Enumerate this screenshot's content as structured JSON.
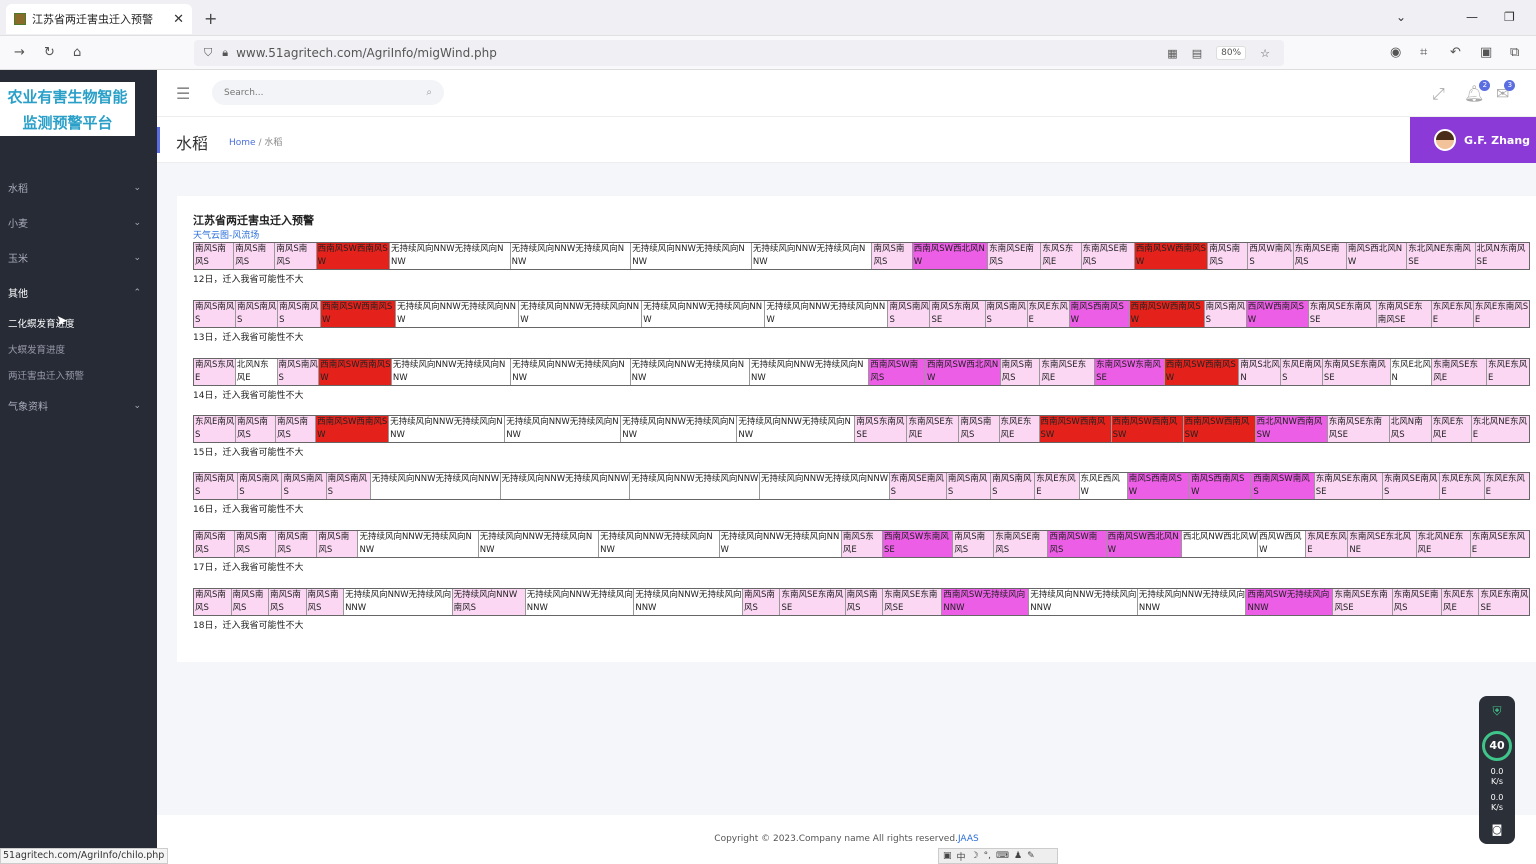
{
  "browser": {
    "tab_title": "江苏省两迁害虫迁入预警",
    "tab_close": "✕",
    "new_tab": "+",
    "url": "www.51agritech.com/AgriInfo/migWind.php",
    "zoom": "80%",
    "status_url": "51agritech.com/AgriInfo/chilo.php"
  },
  "sidebar": {
    "logo_line1": "农业有害生物智能",
    "logo_line2": "监测预警平台",
    "items": [
      {
        "label": "水稻"
      },
      {
        "label": "小麦"
      },
      {
        "label": "玉米"
      },
      {
        "label": "其他"
      }
    ],
    "subitems": [
      {
        "label": "二化螟发育进度"
      },
      {
        "label": "大螟发育进度"
      },
      {
        "label": "两迁害虫迁入预警"
      }
    ],
    "last_item": {
      "label": "气象资料"
    }
  },
  "topbar": {
    "search_placeholder": "Search...",
    "notif_count": "2",
    "mail_count": "3"
  },
  "page": {
    "title": "水稻",
    "crumb_home": "Home",
    "crumb_sep": "/",
    "crumb_current": "水稻",
    "user_name": "G.F. Zhang"
  },
  "card": {
    "title": "江苏省两迁害虫迁入预警",
    "link": "天气云图-风流场"
  },
  "wind_rows": [
    {
      "note": "12日，迁入我省可能性不大",
      "cells": [
        {
          "t": "南风S南风S",
          "c": "p",
          "w": 40
        },
        {
          "t": "南风S南风S",
          "c": "p",
          "w": 41
        },
        {
          "t": "南风S南风S",
          "c": "p",
          "w": 41
        },
        {
          "t": "西南风SW西南风SW",
          "c": "r",
          "w": 73
        },
        {
          "t": "无持续风向NNW无持续风向NNW",
          "c": "w",
          "w": 120
        },
        {
          "t": "无持续风向NNW无持续风向NNW",
          "c": "w",
          "w": 120
        },
        {
          "t": "无持续风向NNW无持续风向NNW",
          "c": "w",
          "w": 120
        },
        {
          "t": "无持续风向NNW无持续风向NNW",
          "c": "w",
          "w": 120
        },
        {
          "t": "南风S南风S",
          "c": "p",
          "w": 40
        },
        {
          "t": "西南风SW西北风NW",
          "c": "m",
          "w": 75
        },
        {
          "t": "东南风SE南风S",
          "c": "p",
          "w": 53
        },
        {
          "t": "东风S东风E",
          "c": "p",
          "w": 40
        },
        {
          "t": "东南风SE南风S",
          "c": "p",
          "w": 53
        },
        {
          "t": "西南风SW西南风SW",
          "c": "r",
          "w": 73
        },
        {
          "t": "南风S南风S",
          "c": "p",
          "w": 40
        },
        {
          "t": "西风W南风S",
          "c": "p",
          "w": 45
        },
        {
          "t": "东南风SE南风S",
          "c": "p",
          "w": 53
        },
        {
          "t": "南风S西北风NW",
          "c": "p",
          "w": 60
        },
        {
          "t": "东北风NE东南风SE",
          "c": "p",
          "w": 68
        },
        {
          "t": "北风N东南风SE",
          "c": "p",
          "w": 53
        }
      ]
    },
    {
      "note": "13日，迁入我省可能性不大",
      "cells": [
        {
          "t": "南风S南风S",
          "c": "p",
          "w": 42
        },
        {
          "t": "南风S南风S",
          "c": "p",
          "w": 42
        },
        {
          "t": "南风S南风S",
          "c": "p",
          "w": 43
        },
        {
          "t": "西南风SW西南风SW",
          "c": "r",
          "w": 75
        },
        {
          "t": "无持续风向NNW无持续风向NNW",
          "c": "w",
          "w": 123
        },
        {
          "t": "无持续风向NNW无持续风向NNW",
          "c": "w",
          "w": 123
        },
        {
          "t": "无持续风向NNW无持续风向NNW",
          "c": "w",
          "w": 123
        },
        {
          "t": "无持续风向NNW无持续风向NNW",
          "c": "w",
          "w": 123
        },
        {
          "t": "南风S南风S",
          "c": "p",
          "w": 42
        },
        {
          "t": "南风S东南风SE",
          "c": "p",
          "w": 55
        },
        {
          "t": "南风S南风S",
          "c": "p",
          "w": 42
        },
        {
          "t": "东风E东风E",
          "c": "p",
          "w": 42
        },
        {
          "t": "南风S西南风SW",
          "c": "m",
          "w": 60
        },
        {
          "t": "西南风SW西南风SW",
          "c": "r",
          "w": 75
        },
        {
          "t": "南风S南风S",
          "c": "p",
          "w": 42
        },
        {
          "t": "西风W西南风SW",
          "c": "m",
          "w": 62
        },
        {
          "t": "东南风SE东南风SE",
          "c": "p",
          "w": 68
        },
        {
          "t": "东南风SE东南风SE",
          "c": "p",
          "w": 55
        },
        {
          "t": "东风E东风E",
          "c": "p",
          "w": 42
        },
        {
          "t": "东风E东南风SE",
          "c": "p",
          "w": 55
        }
      ]
    },
    {
      "note": "14日，迁入我省可能性不大",
      "cells": [
        {
          "t": "南风S东风E",
          "c": "p",
          "w": 42
        },
        {
          "t": "北风N东风E",
          "c": "w",
          "w": 42
        },
        {
          "t": "南风S南风S",
          "c": "p",
          "w": 42
        },
        {
          "t": "西南风SW西南风SW",
          "c": "r",
          "w": 73
        },
        {
          "t": "无持续风向NNW无持续风向NNW",
          "c": "w",
          "w": 120
        },
        {
          "t": "无持续风向NNW无持续风向NNW",
          "c": "w",
          "w": 120
        },
        {
          "t": "无持续风向NNW无持续风向NNW",
          "c": "w",
          "w": 120
        },
        {
          "t": "无持续风向NNW无持续风向NNW",
          "c": "w",
          "w": 120
        },
        {
          "t": "西南风SW南风S",
          "c": "m",
          "w": 57
        },
        {
          "t": "西南风SW西北风NW",
          "c": "m",
          "w": 75
        },
        {
          "t": "南风S南风S",
          "c": "p",
          "w": 40
        },
        {
          "t": "东南风SE东风E",
          "c": "p",
          "w": 55
        },
        {
          "t": "东南风SW东南风SE",
          "c": "m",
          "w": 70
        },
        {
          "t": "西南风SW西南风SW",
          "c": "r",
          "w": 75
        },
        {
          "t": "南风S北风N",
          "c": "p",
          "w": 42
        },
        {
          "t": "东风E南风S",
          "c": "p",
          "w": 42
        },
        {
          "t": "东南风SE东南风SE",
          "c": "p",
          "w": 68
        },
        {
          "t": "东风E北风N",
          "c": "w",
          "w": 42
        },
        {
          "t": "东南风SE东风E",
          "c": "p",
          "w": 55
        },
        {
          "t": "东风E东风E",
          "c": "p",
          "w": 42
        }
      ]
    },
    {
      "note": "15日，迁入我省可能性不大",
      "cells": [
        {
          "t": "东风E南风S",
          "c": "p",
          "w": 42
        },
        {
          "t": "南风S南风S",
          "c": "p",
          "w": 40
        },
        {
          "t": "南风S南风S",
          "c": "p",
          "w": 40
        },
        {
          "t": "西南风SW西南风SW",
          "c": "r",
          "w": 73
        },
        {
          "t": "无持续风向NNW无持续风向NNW",
          "c": "w",
          "w": 116
        },
        {
          "t": "无持续风向NNW无持续风向NNW",
          "c": "w",
          "w": 116
        },
        {
          "t": "无持续风向NNW无持续风向NNW",
          "c": "w",
          "w": 116
        },
        {
          "t": "无持续风向NNW无持续风向NNW",
          "c": "w",
          "w": 118
        },
        {
          "t": "南风S东南风SE",
          "c": "p",
          "w": 52
        },
        {
          "t": "东南风SE东风E",
          "c": "p",
          "w": 52
        },
        {
          "t": "南风S南风S",
          "c": "p",
          "w": 40
        },
        {
          "t": "东风E东风E",
          "c": "p",
          "w": 40
        },
        {
          "t": "西南风SW西南风SW",
          "c": "r",
          "w": 72
        },
        {
          "t": "西南风SW西南风SW",
          "c": "r",
          "w": 72
        },
        {
          "t": "西南风SW西南风SW",
          "c": "r",
          "w": 72
        },
        {
          "t": "西北风NW西南风SW",
          "c": "m",
          "w": 72
        },
        {
          "t": "东南风SE东南风SE",
          "c": "p",
          "w": 62
        },
        {
          "t": "北风N南风S",
          "c": "p",
          "w": 42
        },
        {
          "t": "东风E东风E",
          "c": "p",
          "w": 40
        },
        {
          "t": "东北风NE东风E",
          "c": "p",
          "w": 57
        }
      ]
    },
    {
      "note": "16日，迁入我省可能性不大",
      "cells": [
        {
          "t": "南风S南风S",
          "c": "p",
          "w": 44
        },
        {
          "t": "南风S南风S",
          "c": "p",
          "w": 44
        },
        {
          "t": "南风S南风S",
          "c": "p",
          "w": 44
        },
        {
          "t": "南风S南风S",
          "c": "p",
          "w": 44
        },
        {
          "t": "无持续风向NNW无持续风向NNW",
          "c": "w",
          "w": 129
        },
        {
          "t": "无持续风向NNW无持续风向NNW",
          "c": "w",
          "w": 129
        },
        {
          "t": "无持续风向NNW无持续风向NNW",
          "c": "w",
          "w": 129
        },
        {
          "t": "无持续风向NNW无持续风向NNW",
          "c": "w",
          "w": 129
        },
        {
          "t": "东南风SE南风S",
          "c": "p",
          "w": 57
        },
        {
          "t": "南风S南风S",
          "c": "p",
          "w": 44
        },
        {
          "t": "南风S南风S",
          "c": "p",
          "w": 44
        },
        {
          "t": "东风E东风E",
          "c": "p",
          "w": 44
        },
        {
          "t": "东风E西风W",
          "c": "w",
          "w": 48
        },
        {
          "t": "南风S西南风SW",
          "c": "m",
          "w": 62
        },
        {
          "t": "南风S西南风SW",
          "c": "m",
          "w": 62
        },
        {
          "t": "西南风SW南风S",
          "c": "m",
          "w": 62
        },
        {
          "t": "东南风SE东南风SE",
          "c": "p",
          "w": 68
        },
        {
          "t": "东南风SE南风S",
          "c": "p",
          "w": 57
        },
        {
          "t": "东风E东风E",
          "c": "p",
          "w": 44
        },
        {
          "t": "东风E东风E",
          "c": "p",
          "w": 44
        }
      ]
    },
    {
      "note": "17日，迁入我省可能性不大",
      "cells": [
        {
          "t": "南风S南风S",
          "c": "p",
          "w": 41
        },
        {
          "t": "南风S南风S",
          "c": "p",
          "w": 41
        },
        {
          "t": "南风S南风S",
          "c": "p",
          "w": 41
        },
        {
          "t": "南风S南风S",
          "c": "p",
          "w": 41
        },
        {
          "t": "无持续风向NNW无持续风向NNW",
          "c": "w",
          "w": 120
        },
        {
          "t": "无持续风向NNW无持续风向NNW",
          "c": "w",
          "w": 120
        },
        {
          "t": "无持续风向NNW无持续风向NNW",
          "c": "w",
          "w": 120
        },
        {
          "t": "无持续风向NNW无持续风向NNW",
          "c": "w",
          "w": 122
        },
        {
          "t": "南风S东风E",
          "c": "p",
          "w": 41
        },
        {
          "t": "西南风SW东南风SE",
          "c": "m",
          "w": 70
        },
        {
          "t": "南风S南风S",
          "c": "p",
          "w": 41
        },
        {
          "t": "东南风SE南风S",
          "c": "p",
          "w": 54
        },
        {
          "t": "西南风SW南风S",
          "c": "m",
          "w": 58
        },
        {
          "t": "西南风SW西北风NW",
          "c": "m",
          "w": 75
        },
        {
          "t": "西北风NW西北风W",
          "c": "w",
          "w": 76
        },
        {
          "t": "西风W西风W",
          "c": "w",
          "w": 48
        },
        {
          "t": "东风E东风E",
          "c": "p",
          "w": 42
        },
        {
          "t": "东南风SE东北风NE",
          "c": "p",
          "w": 68
        },
        {
          "t": "东北风NE东风E",
          "c": "p",
          "w": 54
        },
        {
          "t": "东南风SE东风E",
          "c": "p",
          "w": 58
        }
      ]
    },
    {
      "note": "18日，迁入我省可能性不大",
      "cells": [
        {
          "t": "南风S南风S",
          "c": "p",
          "w": 38
        },
        {
          "t": "南风S南风S",
          "c": "p",
          "w": 38
        },
        {
          "t": "南风S南风S",
          "c": "p",
          "w": 38
        },
        {
          "t": "南风S南风S",
          "c": "p",
          "w": 38
        },
        {
          "t": "无持续风向NNW无持续风向NNW",
          "c": "w",
          "w": 110
        },
        {
          "t": "无持续风向NNW南风S",
          "c": "p",
          "w": 74
        },
        {
          "t": "无持续风向NNW无持续风向NNW",
          "c": "w",
          "w": 110
        },
        {
          "t": "无持续风向NNW无持续风向NNW",
          "c": "w",
          "w": 110
        },
        {
          "t": "南风S南风S",
          "c": "p",
          "w": 38
        },
        {
          "t": "东南风SE东南风SE",
          "c": "p",
          "w": 66
        },
        {
          "t": "南风S南风S",
          "c": "p",
          "w": 38
        },
        {
          "t": "东南风SE东南风SE",
          "c": "p",
          "w": 60
        },
        {
          "t": "西南风SW无持续风向NNW",
          "c": "m",
          "w": 88
        },
        {
          "t": "无持续风向NNW无持续风向NNW",
          "c": "w",
          "w": 110
        },
        {
          "t": "无持续风向NNW无持续风向NNW",
          "c": "w",
          "w": 110
        },
        {
          "t": "西南风SW无持续风向NNW",
          "c": "m",
          "w": 88
        },
        {
          "t": "东南风SE东南风SE",
          "c": "p",
          "w": 60
        },
        {
          "t": "东南风SE南风S",
          "c": "p",
          "w": 50
        },
        {
          "t": "东风E东风E",
          "c": "p",
          "w": 38
        },
        {
          "t": "东风E东南风SE",
          "c": "p",
          "w": 50
        }
      ]
    }
  ],
  "footer": {
    "copyright": "Copyright © 2023.Company name All rights reserved.",
    "link": "JAAS"
  },
  "ime": {
    "label": "中"
  },
  "widget": {
    "percent": "40",
    "up": "0.0",
    "up_unit": "K/s",
    "down": "0.0",
    "down_unit": "K/s"
  }
}
